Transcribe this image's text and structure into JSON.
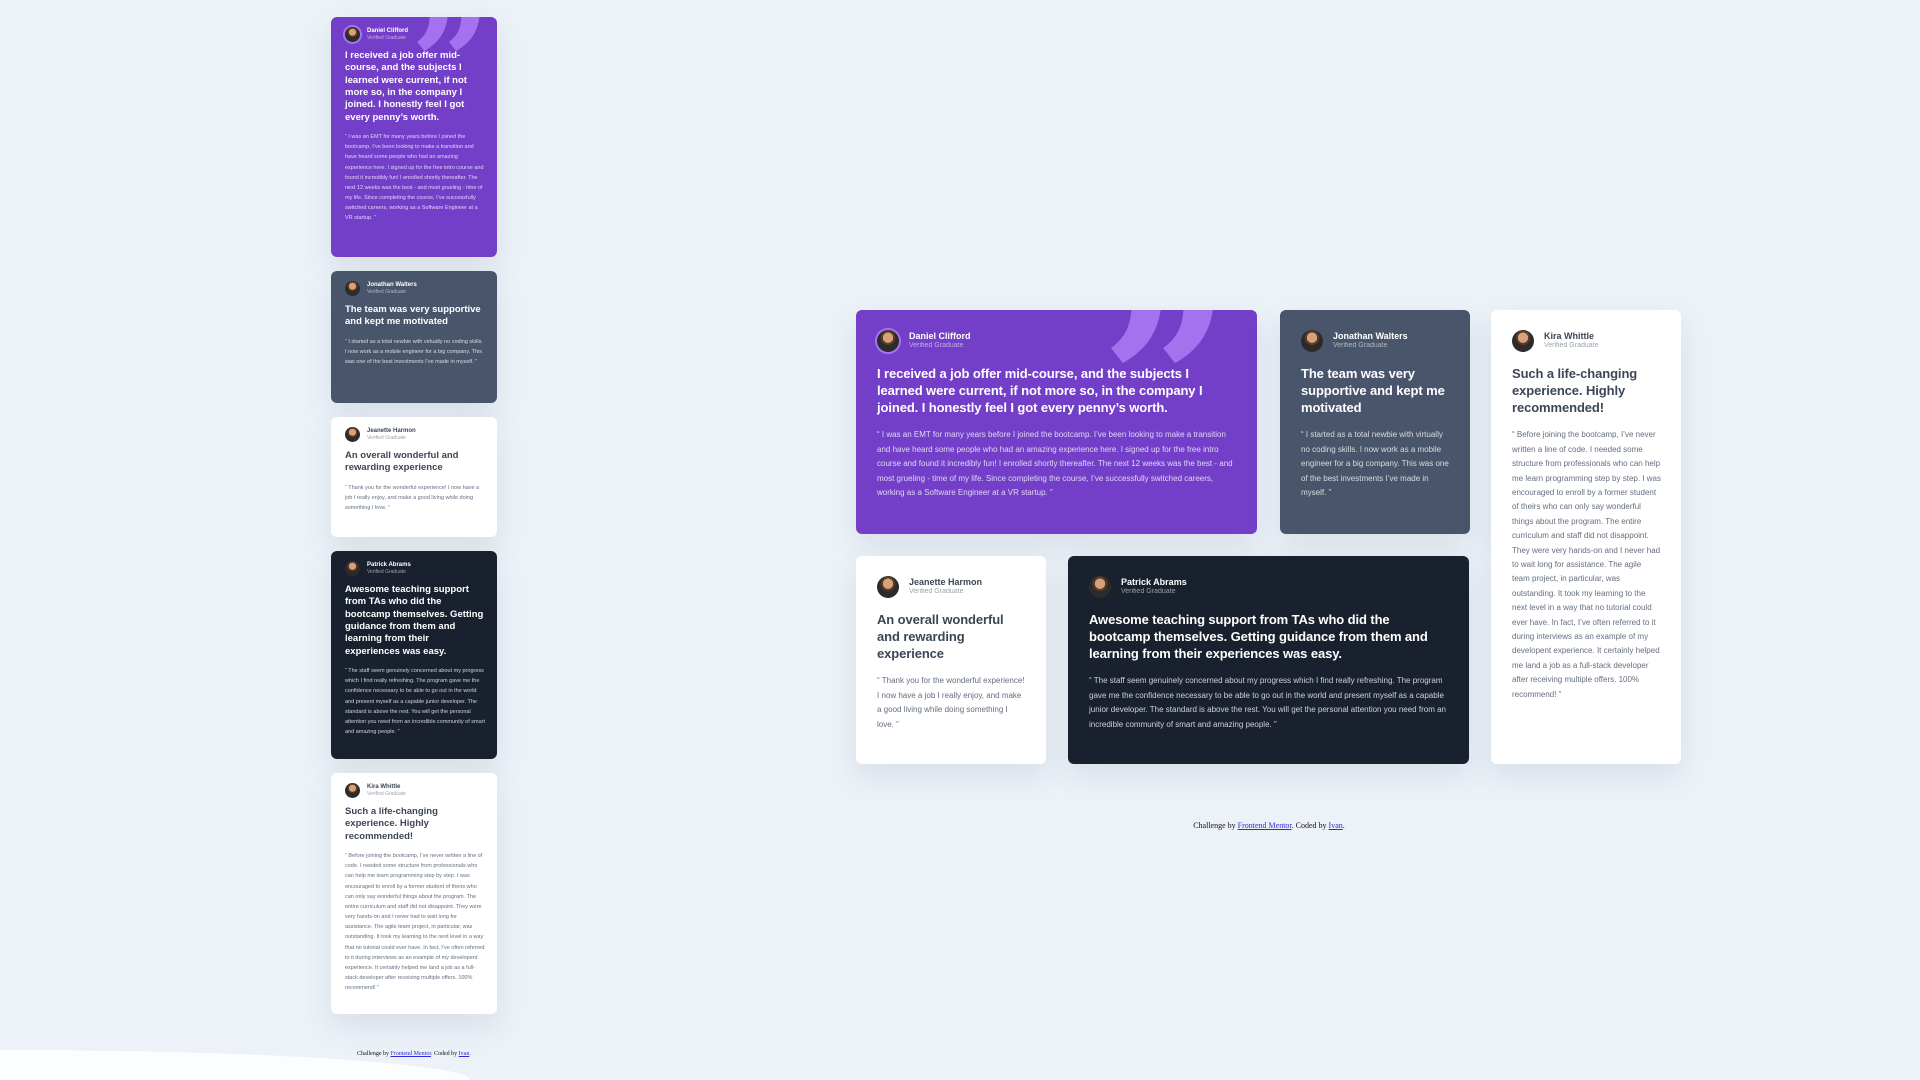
{
  "testimonials": {
    "daniel": {
      "name": "Daniel Clifford",
      "role": "Verified Graduate",
      "headline": "I received a job offer mid-course, and the subjects I learned were current, if not more so, in the company I joined. I honestly feel I got every penny’s worth.",
      "body": "“ I was an EMT for many years before I joined the bootcamp. I’ve been looking to make a transition and have heard some people who had an amazing experience here. I signed up for the free intro course and found it incredibly fun! I enrolled shortly thereafter. The next 12 weeks was the best - and most grueling - time of my life. Since completing the course, I’ve successfully switched careers, working as a Software Engineer at a VR startup. ”"
    },
    "jonathan": {
      "name": "Jonathan Walters",
      "role": "Verified Graduate",
      "headline": "The team was very supportive and kept me motivated",
      "body": "“ I started as a total newbie with virtually no coding skills. I now work as a mobile engineer for a big company. This was one of the best investments I’ve made in myself. ”"
    },
    "jeanette": {
      "name": "Jeanette Harmon",
      "role": "Verified Graduate",
      "headline": "An overall wonderful and rewarding experience",
      "body": "“ Thank you for the wonderful experience! I now have a job I really enjoy, and make a good living while doing something I love. ”"
    },
    "patrick": {
      "name": "Patrick Abrams",
      "role": "Verified Graduate",
      "headline": "Awesome teaching support from TAs who did the bootcamp themselves. Getting guidance from them and learning from their experiences was easy.",
      "body": "“ The staff seem genuinely concerned about my progress which I find really refreshing. The program gave me the confidence necessary to be able to go out in the world and present myself as a capable junior developer. The standard is above the rest. You will get the personal attention you need from an incredible community of smart and amazing people. ”"
    },
    "kira": {
      "name": "Kira Whittle",
      "role": "Verified Graduate",
      "headline": "Such a life-changing experience. Highly recommended!",
      "body": "“ Before joining the bootcamp, I’ve never written a line of code. I needed some structure from professionals who can help me learn programming step by step. I was encouraged to enroll by a former student of theirs who can only say wonderful things about the program. The entire curriculum and staff did not disappoint. They were very hands-on and I never had to wait long for assistance. The agile team project, in particular, was outstanding. It took my learning to the next level in a way that no tutorial could ever have. In fact, I’ve often referred to it during interviews as an example of my developent experience. It certainly helped me land a job as a full-stack developer after receiving multiple offers. 100% recommend! ”"
    }
  },
  "quote_glyph": "”",
  "footer": {
    "prefix": "Challenge by ",
    "link1": "Frontend Mentor",
    "middle": ". Coded by ",
    "link2": "Ivan",
    "suffix": "."
  },
  "colors": {
    "purple": "#733fc8",
    "slate": "#48556a",
    "dark": "#19212e",
    "white": "#ffffff",
    "background": "#ecf2f8",
    "quote_accent": "#a775f1"
  }
}
